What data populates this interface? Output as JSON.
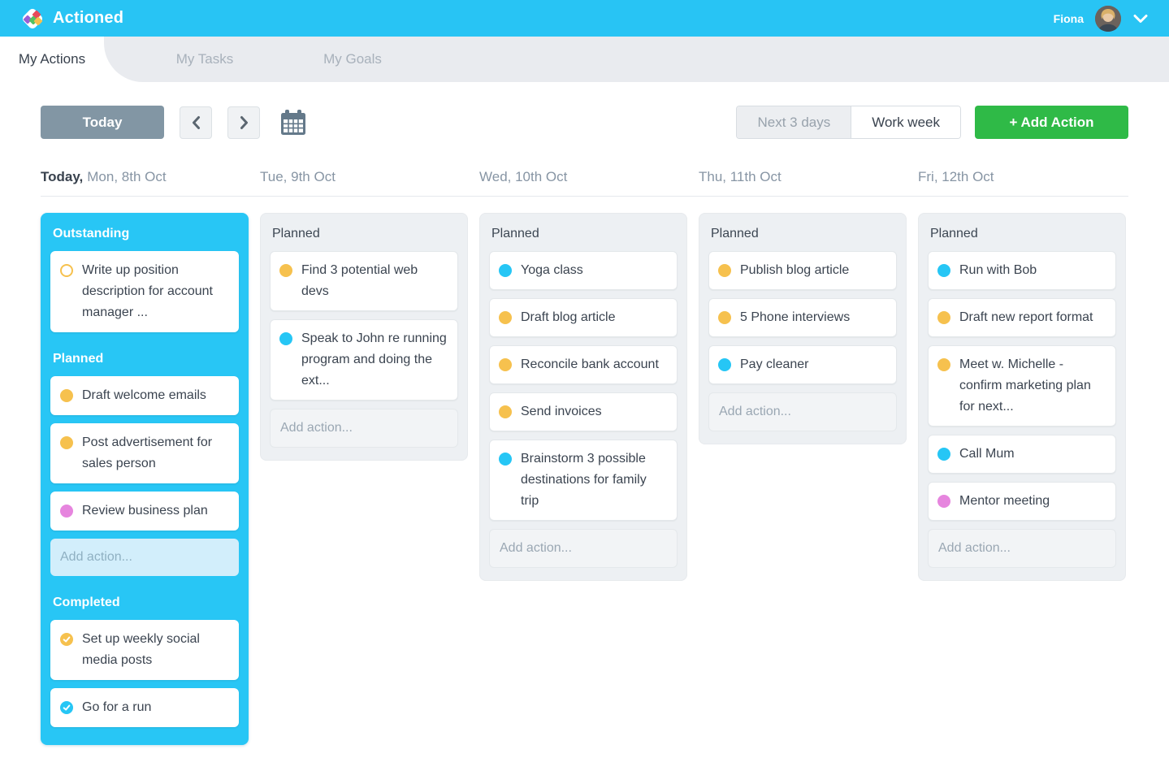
{
  "topbar": {
    "app_name": "Actioned",
    "user_name": "Fiona",
    "icons": {
      "logo": "actioned-diamond-logo",
      "avatar": "user-photo",
      "menu": "chevron-down"
    }
  },
  "tabs": {
    "items": [
      "My Actions",
      "My Tasks",
      "My Goals"
    ],
    "active": "My Actions"
  },
  "toolbar": {
    "today_label": "Today",
    "nav_icons": {
      "prev": "chevron-left",
      "next": "chevron-right",
      "calendar": "calendar"
    },
    "view_toggle": {
      "options": [
        "Next 3 days",
        "Work week"
      ],
      "active": "Work week"
    },
    "add_action_label": "+ Add Action"
  },
  "colors": {
    "brand_cyan": "#28c4f4",
    "today_column_cyan": "#28c6f5",
    "add_action_green": "#2fba47",
    "today_button_slate": "#8296a4",
    "dot_yellow": "#f6c14e",
    "dot_cyan": "#26c6f5",
    "dot_pink": "#e685de"
  },
  "board": {
    "columns": [
      {
        "date_prefix": "Today,",
        "date_label": "Mon, 8th Oct",
        "sections": [
          {
            "title": "Outstanding",
            "cards": [
              {
                "text": "Write up position description for account manager ...",
                "dot": "outline-yellow"
              }
            ]
          },
          {
            "title": "Planned",
            "cards": [
              {
                "text": "Draft welcome emails",
                "dot": "yellow"
              },
              {
                "text": "Post advertisement for sales person",
                "dot": "yellow"
              },
              {
                "text": "Review business plan",
                "dot": "pink"
              }
            ],
            "add_action": "Add action..."
          },
          {
            "title": "Completed",
            "cards": [
              {
                "text": "Set up weekly social media posts",
                "dot": "check-yellow"
              },
              {
                "text": "Go for a run",
                "dot": "check-cyan"
              }
            ]
          }
        ]
      },
      {
        "date_label": "Tue, 9th Oct",
        "sections": [
          {
            "title": "Planned",
            "cards": [
              {
                "text": "Find 3 potential web devs",
                "dot": "yellow"
              },
              {
                "text": "Speak to John re running program and doing the ext...",
                "dot": "cyan"
              }
            ],
            "add_action": "Add action..."
          }
        ]
      },
      {
        "date_label": "Wed, 10th Oct",
        "sections": [
          {
            "title": "Planned",
            "cards": [
              {
                "text": "Yoga class",
                "dot": "cyan"
              },
              {
                "text": "Draft blog article",
                "dot": "yellow"
              },
              {
                "text": "Reconcile bank account",
                "dot": "yellow"
              },
              {
                "text": "Send invoices",
                "dot": "yellow"
              },
              {
                "text": "Brainstorm 3 possible destinations for family trip",
                "dot": "cyan"
              }
            ],
            "add_action": "Add action..."
          }
        ]
      },
      {
        "date_label": "Thu, 11th Oct",
        "sections": [
          {
            "title": "Planned",
            "cards": [
              {
                "text": "Publish blog article",
                "dot": "yellow"
              },
              {
                "text": "5 Phone interviews",
                "dot": "yellow"
              },
              {
                "text": "Pay cleaner",
                "dot": "cyan"
              }
            ],
            "add_action": "Add action..."
          }
        ]
      },
      {
        "date_label": "Fri, 12th Oct",
        "sections": [
          {
            "title": "Planned",
            "cards": [
              {
                "text": "Run with Bob",
                "dot": "cyan"
              },
              {
                "text": "Draft new report format",
                "dot": "yellow"
              },
              {
                "text": "Meet w. Michelle - confirm marketing plan for next...",
                "dot": "yellow"
              },
              {
                "text": "Call Mum",
                "dot": "cyan"
              },
              {
                "text": "Mentor meeting",
                "dot": "pink"
              }
            ],
            "add_action": "Add action..."
          }
        ]
      }
    ]
  }
}
